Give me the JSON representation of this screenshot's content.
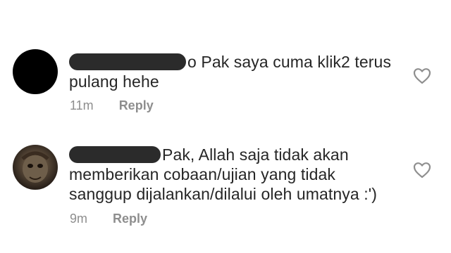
{
  "comments": [
    {
      "username": "",
      "text_line1": "o Pak saya cuma klik2 terus",
      "text_line2": "pulang hehe",
      "time": "11m",
      "reply_label": "Reply",
      "avatar_icon": "avatar-black",
      "like_icon": "heart-outline-icon"
    },
    {
      "username": "",
      "text_line1": "Pak, Allah saja tidak akan",
      "text_line2": "memberikan cobaan/ujian yang tidak",
      "text_line3": "sanggup dijalankan/dilalui oleh umatnya :')",
      "time": "9m",
      "reply_label": "Reply",
      "avatar_icon": "avatar-photo",
      "like_icon": "heart-outline-icon"
    }
  ]
}
